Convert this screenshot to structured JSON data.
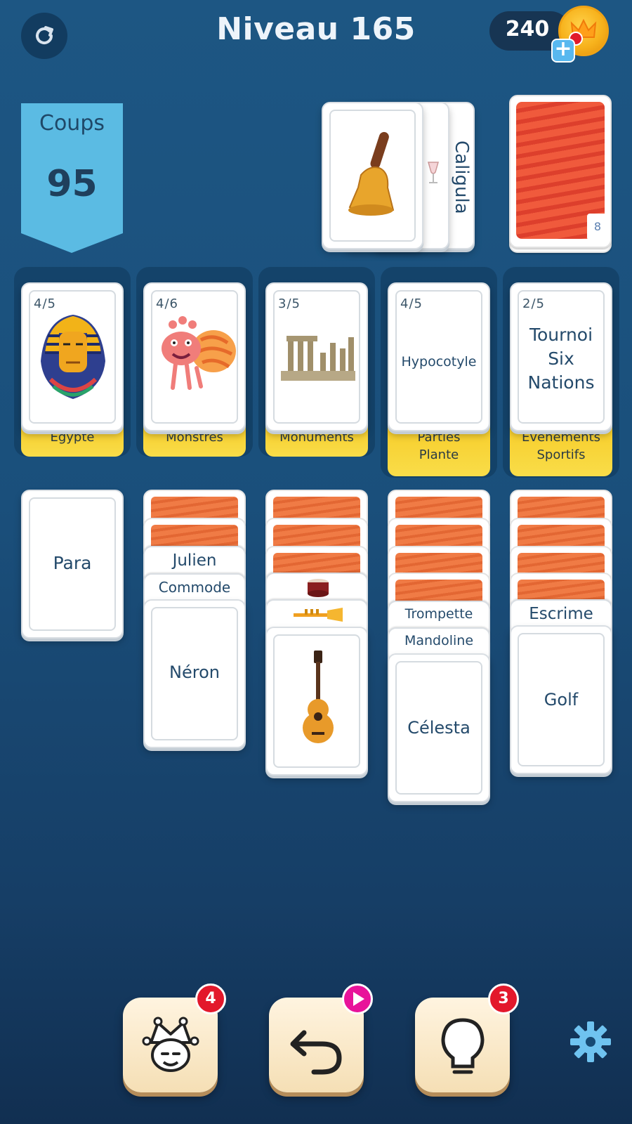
{
  "header": {
    "title": "Niveau 165",
    "coins": "240"
  },
  "moves": {
    "label": "Coups",
    "value": "95"
  },
  "waste": {
    "top_card_icon": "bell-icon",
    "middle_card_icon": "wine-glass-icon",
    "back_card_label": "Caligula"
  },
  "stock": {
    "mini_label": "8"
  },
  "categories": [
    {
      "count": "4/5",
      "name": "Egypte",
      "icon": "pharaoh-icon"
    },
    {
      "count": "4/6",
      "name": "Monstres",
      "icon": "monster-icon"
    },
    {
      "count": "3/5",
      "name": "Monuments",
      "icon": "ruins-icon"
    },
    {
      "count": "4/5",
      "name": "Parties Plante",
      "card_text": "Hypocotyle"
    },
    {
      "count": "2/5",
      "name": "Évènements Sportifs",
      "card_text": "Tournoi Six Nations"
    }
  ],
  "columns": [
    {
      "cards": [
        "Para"
      ]
    },
    {
      "cards": [
        "Julien",
        "Commode",
        "Néron"
      ]
    },
    {
      "cards": [
        "drum-icon",
        "trumpet-icon",
        "guitar-icon"
      ]
    },
    {
      "cards": [
        "Trompette",
        "Mandoline",
        "Célesta"
      ]
    },
    {
      "cards": [
        "Escrime",
        "Golf"
      ]
    }
  ],
  "tools": {
    "joker_badge": "4",
    "hint_badge": "3"
  },
  "colors": {
    "background": "#1d5683",
    "tab_yellow": "#f7cc28",
    "banner_blue": "#5bbbe3",
    "card_back": "#f07b45",
    "badge_red": "#e3182b",
    "video_badge": "#e8139a"
  }
}
